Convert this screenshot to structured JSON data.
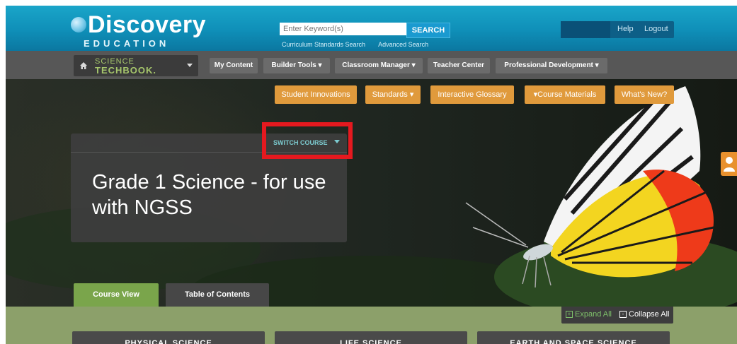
{
  "header": {
    "logo_text": "Discovery",
    "logo_sub": "EDUCATION",
    "search_placeholder": "Enter Keyword(s)",
    "search_button": "SEARCH",
    "links": [
      "Curriculum Standards Search",
      "Advanced Search"
    ],
    "help": "Help",
    "logout": "Logout"
  },
  "nav": {
    "techbook_line1": "SCIENCE",
    "techbook_line2": "TECHBOOK.",
    "items": [
      "My Content",
      "Builder Tools ▾",
      "Classroom Manager ▾",
      "Teacher Center",
      "Professional Development ▾"
    ]
  },
  "subnav": {
    "items": [
      "Student Innovations",
      "Standards ▾",
      "Interactive Glossary",
      "▾Course Materials",
      "What's New?"
    ]
  },
  "course": {
    "switch_label": "SWITCH COURSE",
    "title": "Grade 1 Science - for use with NGSS"
  },
  "tabs": [
    "Course View",
    "Table of Contents"
  ],
  "controls": {
    "expand_all": "Expand All",
    "collapse_all": "Collapse All"
  },
  "categories": [
    "PHYSICAL SCIENCE",
    "LIFE SCIENCE",
    "EARTH AND SPACE SCIENCE"
  ],
  "colors": {
    "header_blue": "#0f8fb8",
    "nav_gray": "#575757",
    "accent_orange": "#e09a3c",
    "highlight_red": "#e5191f",
    "content_green": "#8ca06a",
    "active_tab_green": "#7aa54b"
  }
}
